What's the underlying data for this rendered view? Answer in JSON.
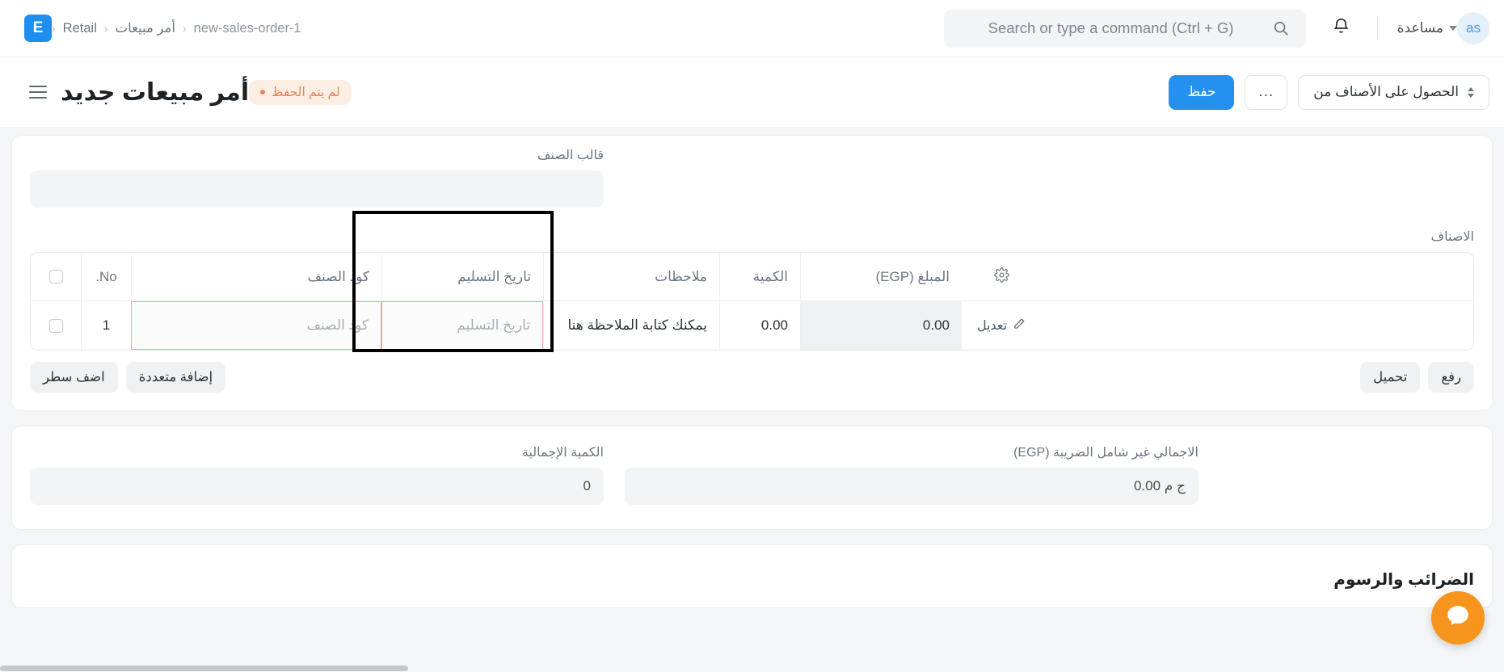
{
  "navbar": {
    "logo_text": "E",
    "breadcrumbs": [
      {
        "label": "Retail",
        "active": false
      },
      {
        "label": "أمر مبيعات",
        "active": false
      },
      {
        "label": "new-sales-order-1",
        "active": true
      }
    ],
    "separator": "‹",
    "search_placeholder": "Search or type a command (Ctrl + G)",
    "search_icon": "search-icon",
    "bell_icon": "bell-icon",
    "help_label": "مساعدة",
    "avatar_initials": "as"
  },
  "page_head": {
    "title": "أمر مبيعات جديد",
    "status_badge": "لم يتم الحفظ",
    "save_label": "حفظ",
    "more_label": "...",
    "get_items_label": "الحصول على الأصناف من"
  },
  "form": {
    "item_template_label": "قالب الصنف",
    "item_template_value": "",
    "items_label": "الاصناف"
  },
  "grid": {
    "columns": [
      {
        "key": "no",
        "label": "No."
      },
      {
        "key": "item_code",
        "label": "كود الصنف"
      },
      {
        "key": "delivery_date",
        "label": "تاريخ التسليم"
      },
      {
        "key": "notes",
        "label": "ملاحظات"
      },
      {
        "key": "qty",
        "label": "الكمية"
      },
      {
        "key": "amount",
        "label": "المبلغ (EGP)"
      },
      {
        "key": "settings",
        "label": "gear-icon"
      }
    ],
    "rows": [
      {
        "no": "1",
        "item_code_placeholder": "كود الصنف",
        "delivery_date_placeholder": "تاريخ التسليم",
        "notes": "يمكنك كتابة الملاحظة هنا",
        "qty": "0.00",
        "amount": "0.00",
        "edit_label": "تعديل"
      }
    ],
    "footer_right": [
      {
        "label": "اضف سطر"
      },
      {
        "label": "إضافة متعددة"
      }
    ],
    "footer_left": [
      {
        "label": "تحميل"
      },
      {
        "label": "رفع"
      }
    ]
  },
  "totals": {
    "total_qty_label": "الكمية الإجمالية",
    "total_qty_value": "0",
    "net_total_label": "الاجمالي غير شامل الضريبة (EGP)",
    "net_total_value": "ج م 0.00"
  },
  "taxes": {
    "section_title": "الضرائب والرسوم"
  },
  "chat": {
    "icon": "chat-icon"
  },
  "colors": {
    "primary": "#2490ef",
    "warning": "#ef8354",
    "warning_bg": "#fdeee4",
    "chat": "#f7941d",
    "required_border": "#e8a9a4",
    "page_bg": "#f4f5f6"
  }
}
